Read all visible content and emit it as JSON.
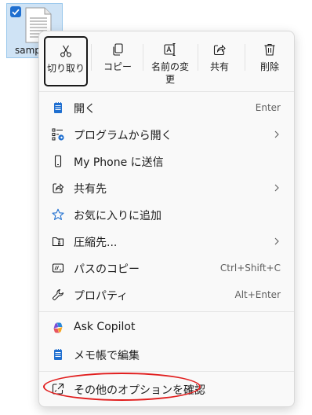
{
  "desktop": {
    "file_name": "samp"
  },
  "toolbar": {
    "cut_label": "切り取り",
    "copy_label": "コピー",
    "rename_label": "名前の変更",
    "share_label": "共有",
    "delete_label": "削除"
  },
  "menu": {
    "items": [
      {
        "label": "開く",
        "shortcut": "Enter",
        "icon": "notepad-icon"
      },
      {
        "label": "プログラムから開く",
        "shortcut": "",
        "icon": "open-with-icon"
      },
      {
        "label": "My Phone に送信",
        "shortcut": "",
        "icon": "phone-icon"
      },
      {
        "label": "共有先",
        "shortcut": "",
        "icon": "share-to-icon"
      },
      {
        "label": "お気に入りに追加",
        "shortcut": "",
        "icon": "star-icon"
      },
      {
        "label": "圧縮先...",
        "shortcut": "",
        "icon": "zip-icon"
      },
      {
        "label": "パスのコピー",
        "shortcut": "Ctrl+Shift+C",
        "icon": "copy-path-icon"
      },
      {
        "label": "プロパティ",
        "shortcut": "Alt+Enter",
        "icon": "wrench-icon"
      },
      {
        "label": "Ask Copilot",
        "shortcut": "",
        "icon": "copilot-icon"
      },
      {
        "label": "メモ帳で編集",
        "shortcut": "",
        "icon": "notepad-icon"
      },
      {
        "label": "その他のオプションを確認",
        "shortcut": "",
        "icon": "more-options-icon"
      }
    ]
  },
  "colors": {
    "accent": "#1f6fd0",
    "highlight": "#e11e1e"
  }
}
